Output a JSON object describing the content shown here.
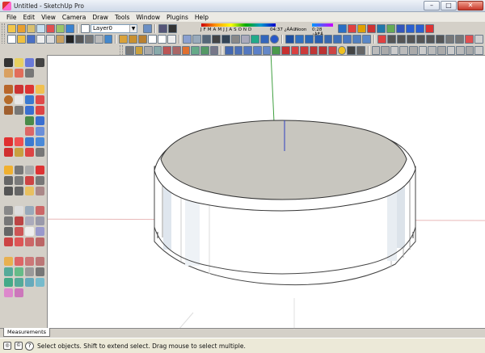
{
  "window": {
    "title": "Untitled - SketchUp Pro"
  },
  "menu": [
    "File",
    "Edit",
    "View",
    "Camera",
    "Draw",
    "Tools",
    "Window",
    "Plugins",
    "Help"
  ],
  "layers": {
    "current": "Layer0"
  },
  "shadows": {
    "months": [
      "J",
      "F",
      "M",
      "A",
      "M",
      "J",
      "J",
      "A",
      "S",
      "O",
      "N",
      "D"
    ],
    "time_start": "04:37 ¿ÀÀü",
    "noon": "Noon",
    "time_end": "0:28 ¿ÀÈÄ"
  },
  "measurements_label": "Measurements",
  "status_text": "Select objects. Shift to extend select. Drag mouse to select multiple.",
  "colors": {
    "cylinder_top": "#c8c6bf",
    "cylinder_side": "#ffffff",
    "axis_red": "#d04040",
    "axis_green": "#40a040",
    "axis_blue": "#3040c0"
  }
}
